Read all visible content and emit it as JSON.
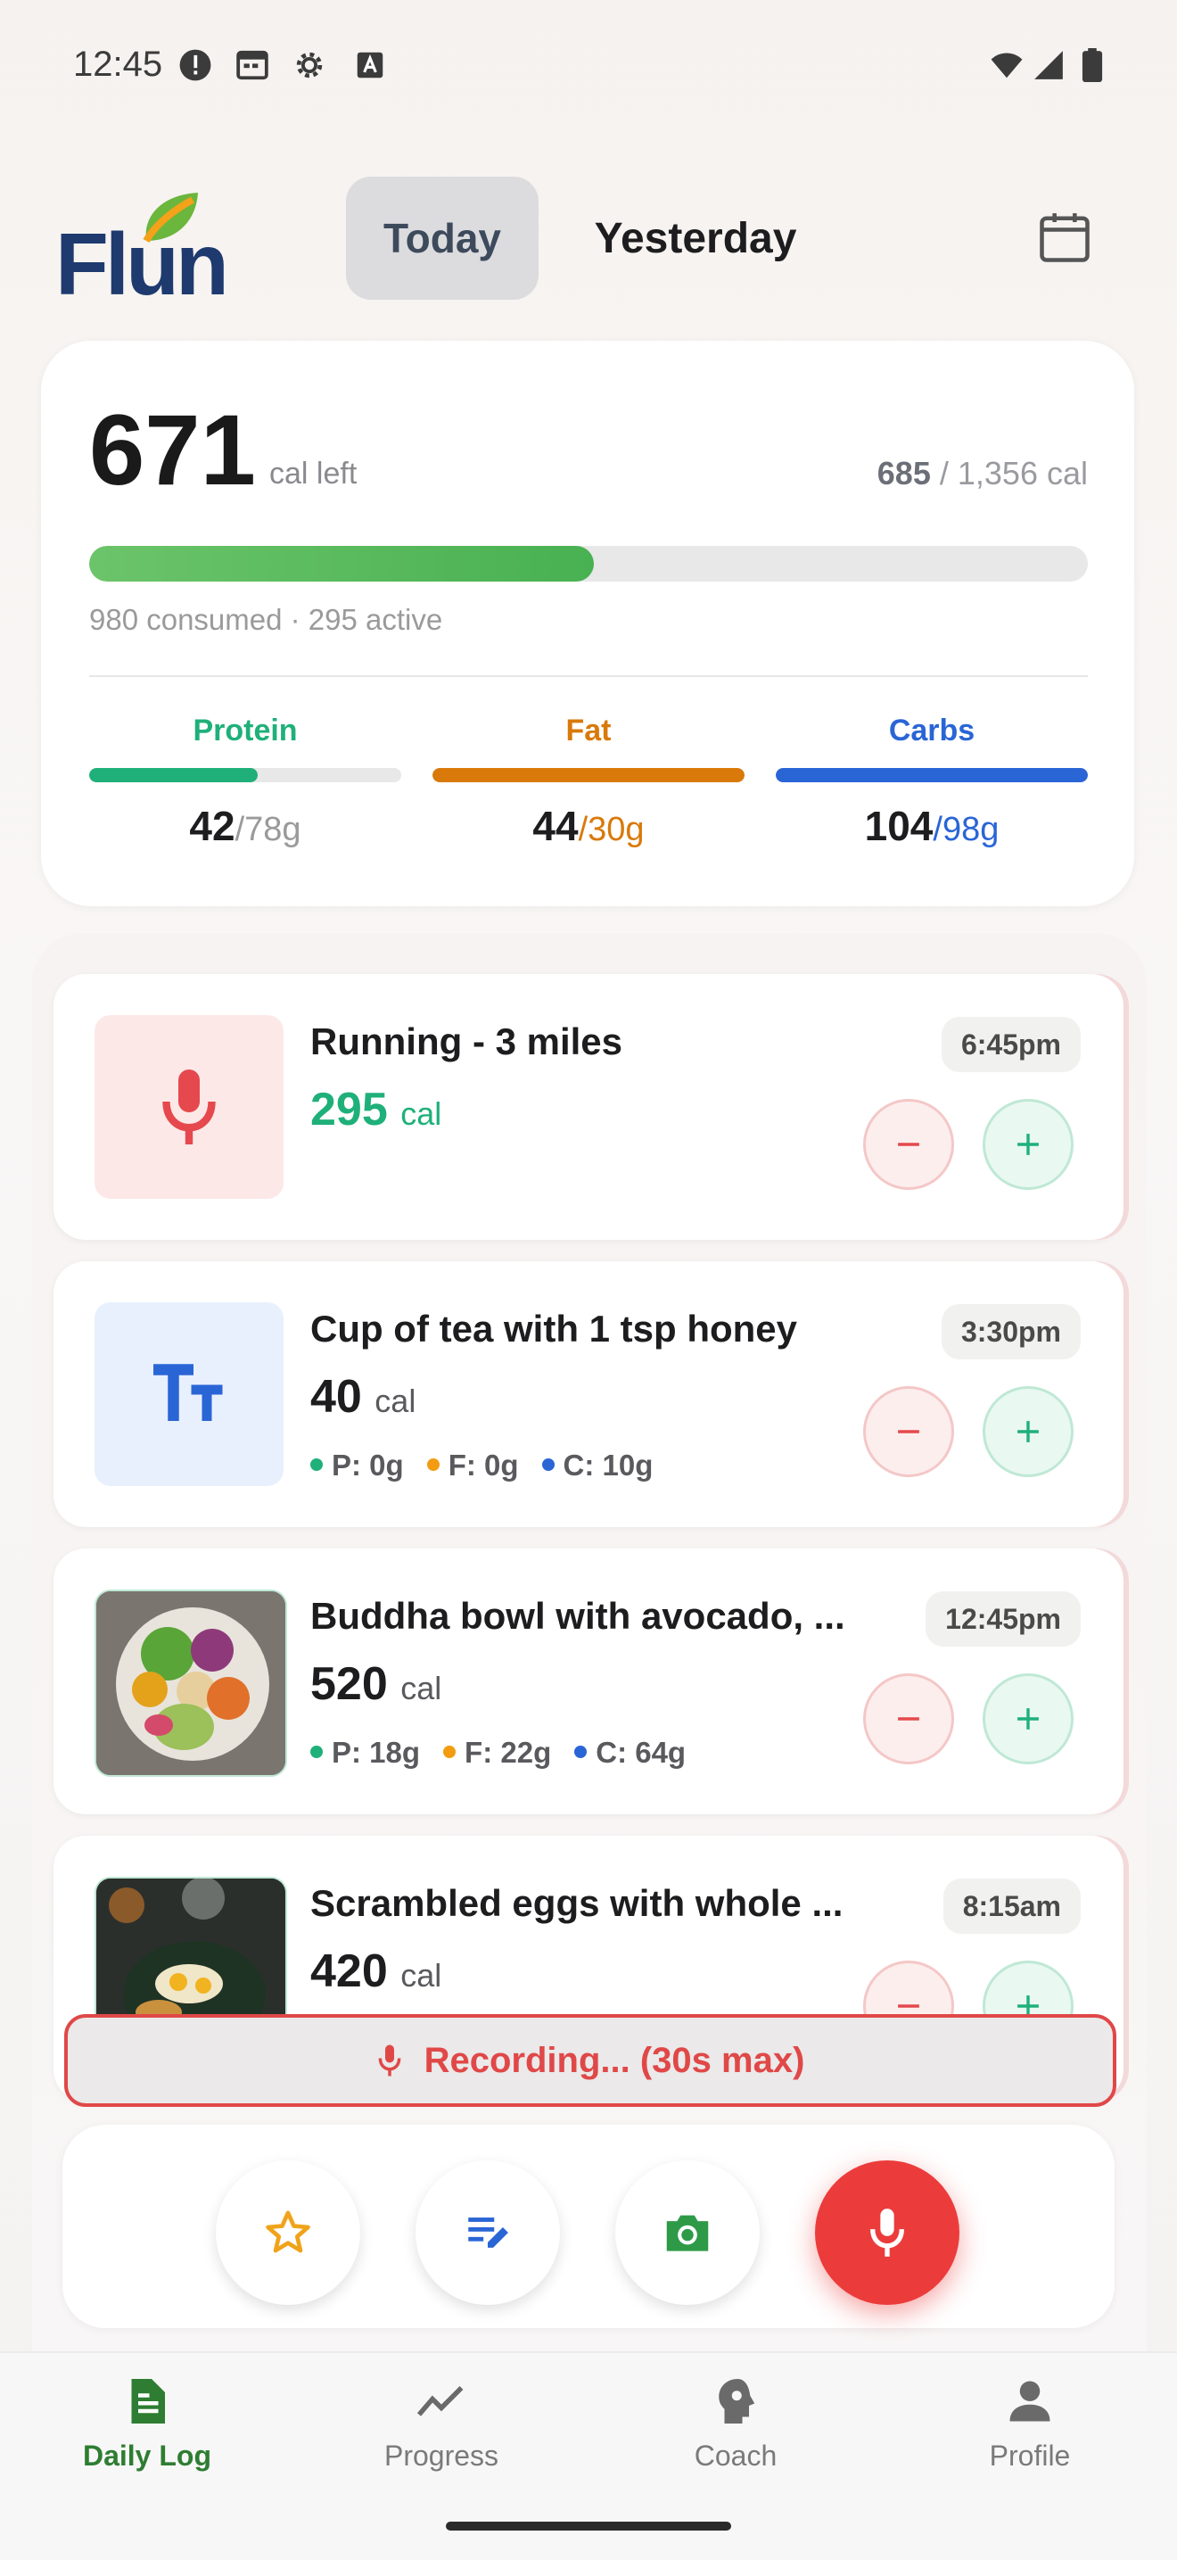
{
  "status_bar": {
    "time": "12:45"
  },
  "header": {
    "logo": "Flun",
    "tabs": [
      "Today",
      "Yesterday"
    ],
    "calendar_icon": "calendar-icon"
  },
  "summary": {
    "calories_left": "671",
    "calories_left_label": "cal left",
    "consumed_total": "685",
    "goal_total": "/ 1,356 cal",
    "progress_fraction": 0.505,
    "breakdown": "980 consumed · 295 active",
    "macros": [
      {
        "label": "Protein",
        "value": "42",
        "goal": "/78g",
        "fraction": 0.54,
        "color": "#1fb07a"
      },
      {
        "label": "Fat",
        "value": "44",
        "goal": "/30g",
        "fraction": 1.0,
        "color": "#d9790a"
      },
      {
        "label": "Carbs",
        "value": "104",
        "goal": "/98g",
        "fraction": 1.0,
        "color": "#2a65d6"
      }
    ]
  },
  "entries": [
    {
      "title": "Running - 3 miles",
      "calories": "295",
      "unit": "cal",
      "time": "6:45pm",
      "type": "voice",
      "cal_color": "#1fb07a",
      "macros": null
    },
    {
      "title": "Cup of tea with 1 tsp honey",
      "calories": "40",
      "unit": "cal",
      "time": "3:30pm",
      "type": "text",
      "cal_color": "#1d1d1f",
      "macros": {
        "p": "P: 0g",
        "f": "F: 0g",
        "c": "C: 10g"
      }
    },
    {
      "title": "Buddha bowl with avocado, ...",
      "calories": "520",
      "unit": "cal",
      "time": "12:45pm",
      "type": "photo",
      "cal_color": "#1d1d1f",
      "macros": {
        "p": "P: 18g",
        "f": "F: 22g",
        "c": "C: 64g"
      }
    },
    {
      "title": "Scrambled eggs with whole ...",
      "calories": "420",
      "unit": "cal",
      "time": "8:15am",
      "type": "photo",
      "cal_color": "#1d1d1f",
      "macros": null
    }
  ],
  "recording": "Recording... (30s max)",
  "actions": [
    "star-icon",
    "edit-list-icon",
    "camera-icon",
    "mic-icon"
  ],
  "nav": [
    {
      "label": "Daily Log",
      "icon": "document-icon",
      "active": true
    },
    {
      "label": "Progress",
      "icon": "trend-icon",
      "active": false
    },
    {
      "label": "Coach",
      "icon": "head-gear-icon",
      "active": false
    },
    {
      "label": "Profile",
      "icon": "person-icon",
      "active": false
    }
  ]
}
